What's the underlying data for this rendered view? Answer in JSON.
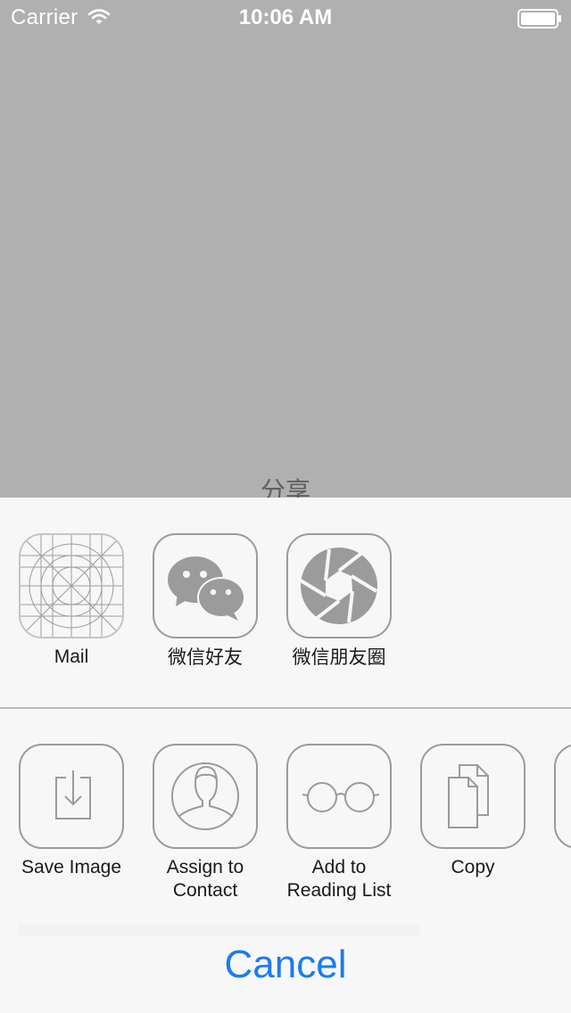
{
  "status_bar": {
    "carrier": "Carrier",
    "time": "10:06 AM"
  },
  "background": {
    "title": "分享",
    "color": "#b0b0b0"
  },
  "share_sheet": {
    "apps": [
      {
        "label": "Mail",
        "icon": "mail-placeholder-icon"
      },
      {
        "label": "微信好友",
        "icon": "wechat-icon"
      },
      {
        "label": "微信朋友圈",
        "icon": "wechat-moments-icon"
      }
    ],
    "actions": [
      {
        "label_line1": "Save Image",
        "label_line2": "",
        "icon": "save-image-icon"
      },
      {
        "label_line1": "Assign to",
        "label_line2": "Contact",
        "icon": "contact-icon"
      },
      {
        "label_line1": "Add to",
        "label_line2": "Reading List",
        "icon": "reading-glasses-icon"
      },
      {
        "label_line1": "Copy",
        "label_line2": "",
        "icon": "copy-icon"
      }
    ],
    "cancel_label": "Cancel"
  },
  "colors": {
    "accent": "#1a7cf0",
    "sheet_background": "#f7f7f7",
    "icon_gray": "#9b9b9b"
  }
}
